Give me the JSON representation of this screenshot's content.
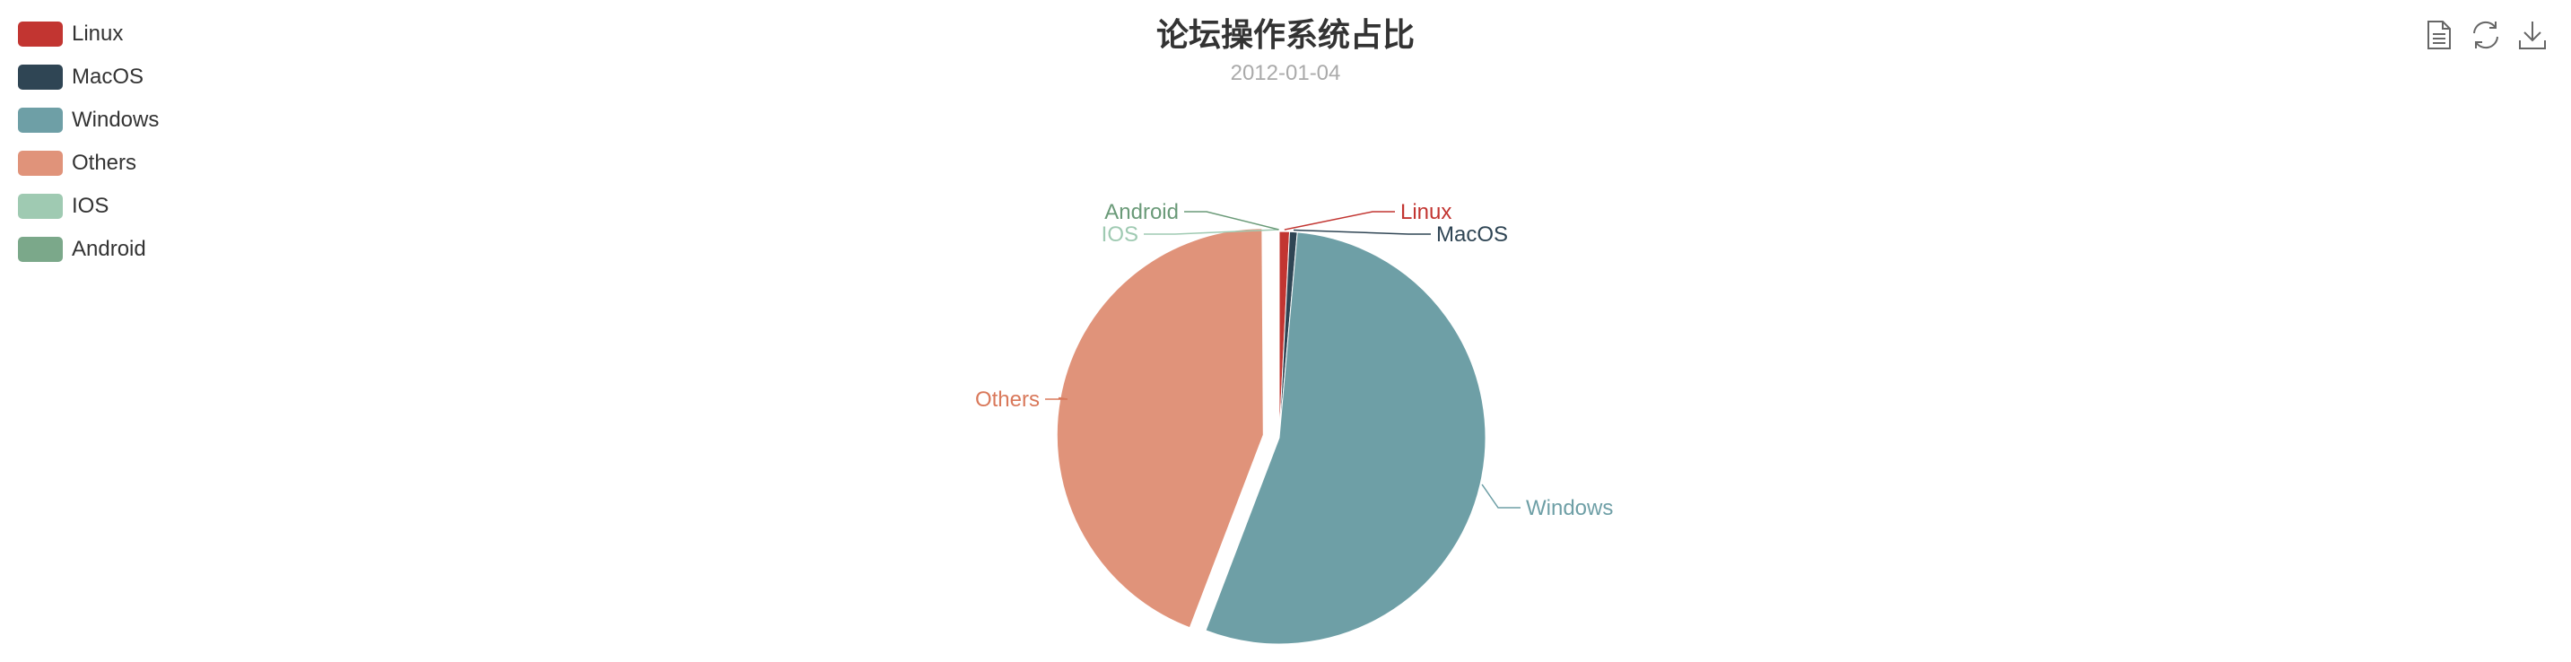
{
  "chart_data": {
    "type": "pie",
    "title": "论坛操作系统占比",
    "subtitle": "2012-01-04",
    "legend_position": "top-left",
    "categories": [
      "Linux",
      "MacOS",
      "Windows",
      "Others",
      "IOS",
      "Android"
    ],
    "values": [
      0.8,
      0.6,
      54.4,
      44.1,
      0.05,
      0.05
    ],
    "colors": [
      "#c23531",
      "#2f4554",
      "#6e9fa6",
      "#e0937a",
      "#9fcab2",
      "#7ba88a"
    ],
    "label_colors": [
      "#c23531",
      "#2f4554",
      "#6e9fa6",
      "#d9785a",
      "#9fcab2",
      "#6a9a78"
    ],
    "selected_slice": "Others"
  },
  "toolbox": {
    "icons": [
      "data-view-icon",
      "restore-icon",
      "save-image-icon"
    ]
  }
}
